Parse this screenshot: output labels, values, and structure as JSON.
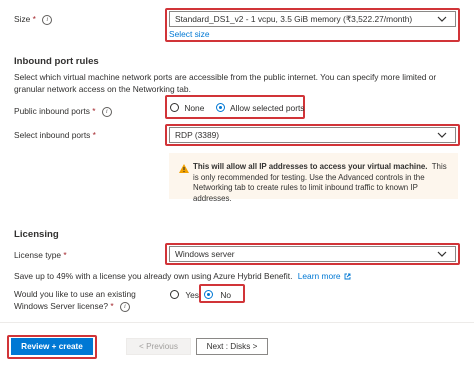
{
  "size": {
    "label": "Size",
    "value": "Standard_DS1_v2 - 1 vcpu, 3.5 GiB memory (₹3,522.27/month)",
    "select_link": "Select size"
  },
  "inbound": {
    "heading": "Inbound port rules",
    "description": "Select which virtual machine network ports are accessible from the public internet. You can specify more limited or granular network access on the Networking tab.",
    "public_label": "Public inbound ports",
    "option_none": "None",
    "option_allow": "Allow selected ports",
    "selected_option": "Allow selected ports",
    "select_ports_label": "Select inbound ports",
    "ports_value": "RDP (3389)",
    "warning_bold": "This will allow all IP addresses to access your virtual machine.",
    "warning_text": "This is only recommended for testing.  Use the Advanced controls in the Networking tab to create rules to limit inbound traffic to known IP addresses."
  },
  "licensing": {
    "heading": "Licensing",
    "license_label": "License type",
    "license_value": "Windows server",
    "savings_text": "Save up to 49% with a license you already own using Azure Hybrid Benefit.",
    "learn_more": "Learn more",
    "existing_label": "Would you like to use an existing Windows Server license?",
    "option_yes": "Yes",
    "option_no": "No",
    "selected_option": "No"
  },
  "footer": {
    "review_create": "Review + create",
    "previous": "< Previous",
    "next": "Next : Disks >"
  },
  "colors": {
    "accent": "#0078d4",
    "highlight_border": "#d13438",
    "warning_bg": "#fdf6ed",
    "warning_icon": "#f2a100"
  }
}
